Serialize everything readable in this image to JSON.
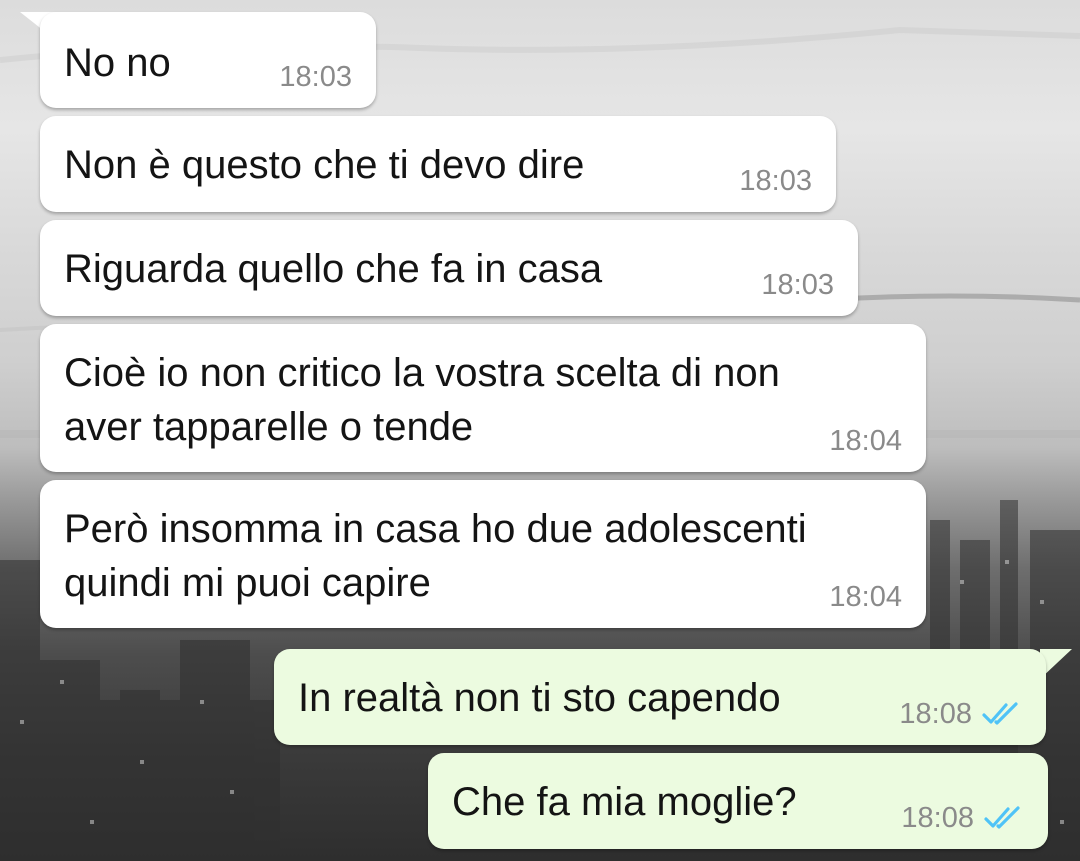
{
  "colors": {
    "incoming_bubble": "#ffffff",
    "outgoing_bubble": "#ecfbe0",
    "timestamp": "#8a8a8a",
    "read_ticks": "#4fc3f7"
  },
  "messages": [
    {
      "direction": "incoming",
      "lines": [
        "No no"
      ],
      "time": "18:03"
    },
    {
      "direction": "incoming",
      "lines": [
        "Non è questo che ti devo dire"
      ],
      "time": "18:03"
    },
    {
      "direction": "incoming",
      "lines": [
        "Riguarda quello che fa in casa"
      ],
      "time": "18:03"
    },
    {
      "direction": "incoming",
      "lines": [
        "Cioè io non critico la vostra scelta di non",
        "aver tapparelle o tende"
      ],
      "time": "18:04"
    },
    {
      "direction": "incoming",
      "lines": [
        "Però insomma in casa ho due adolescenti",
        "quindi mi puoi capire"
      ],
      "time": "18:04"
    },
    {
      "direction": "outgoing",
      "lines": [
        "In realtà non ti sto capendo"
      ],
      "time": "18:08",
      "status_icon": "double-check-read-icon"
    },
    {
      "direction": "outgoing",
      "lines": [
        "Che fa mia moglie?"
      ],
      "time": "18:08",
      "status_icon": "double-check-read-icon"
    }
  ]
}
